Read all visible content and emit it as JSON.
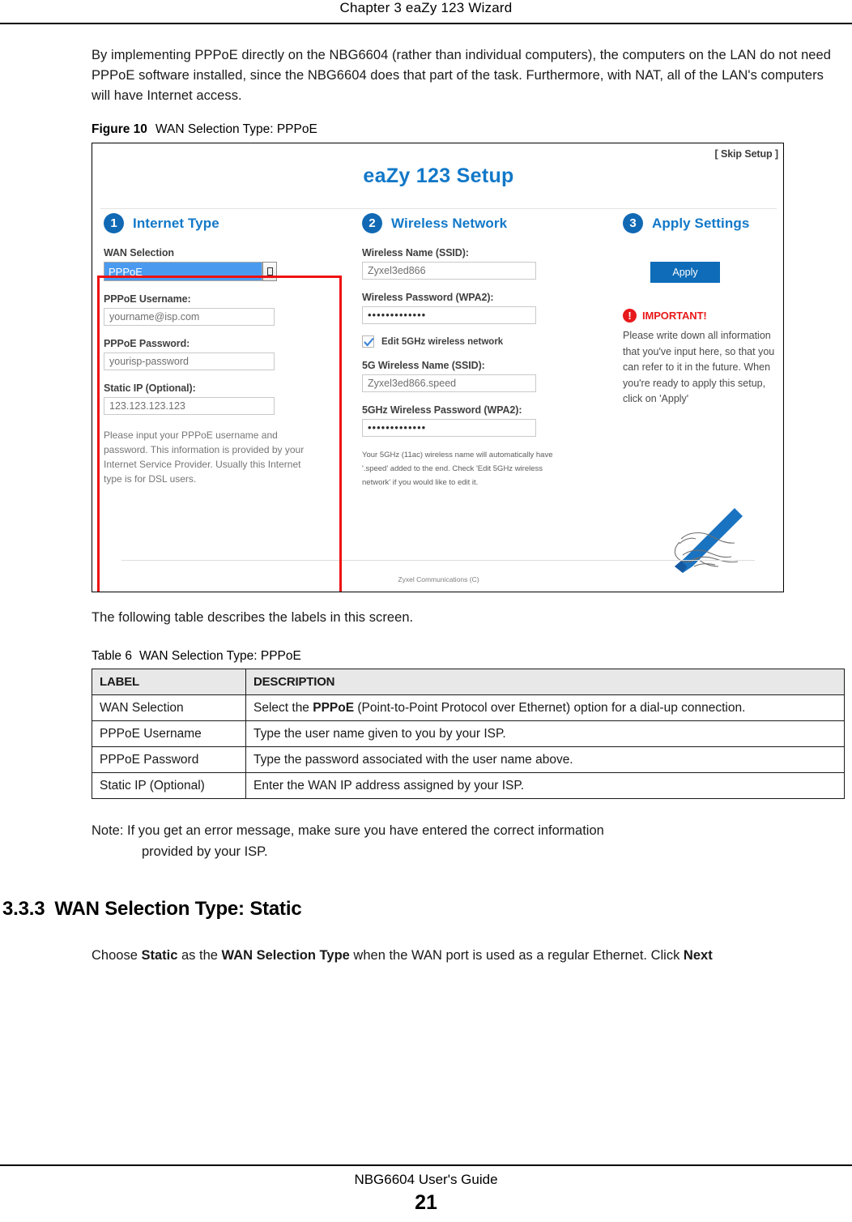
{
  "header": {
    "chapter": "Chapter 3 eaZy 123 Wizard"
  },
  "intro_paragraph": "By implementing PPPoE directly on the NBG6604 (rather than individual computers), the computers on the LAN do not need PPPoE software installed, since the NBG6604 does that part of the task. Furthermore, with NAT, all of the LAN's computers will have Internet access.",
  "figure": {
    "label": "Figure 10",
    "caption": "WAN Selection Type: PPPoE",
    "skip_setup": "[ Skip Setup ]",
    "wizard_title": "eaZy 123 Setup",
    "footer_note": "Zyxel Communications (C)",
    "step1": {
      "number": "1",
      "title": "Internet Type",
      "wan_selection_label": "WAN Selection",
      "wan_selection_value": "PPPoE",
      "username_label": "PPPoE Username:",
      "username_value": "yourname@isp.com",
      "password_label": "PPPoE Password:",
      "password_value": "yourisp-password",
      "static_ip_label": "Static IP (Optional):",
      "static_ip_value": "123.123.123.123",
      "hint": "Please input your PPPoE username and password. This information is provided by your Internet Service Provider. Usually this Internet type is for DSL users."
    },
    "step2": {
      "number": "2",
      "title": "Wireless Network",
      "ssid_label": "Wireless Name (SSID):",
      "ssid_value": "Zyxel3ed866",
      "wpa2_label": "Wireless Password (WPA2):",
      "wpa2_value": "•••••••••••••",
      "edit5g_label": "Edit 5GHz wireless network",
      "ssid5g_label": "5G Wireless Name (SSID):",
      "ssid5g_value": "Zyxel3ed866.speed",
      "wpa25g_label": "5GHz Wireless Password (WPA2):",
      "wpa25g_value": "•••••••••••••",
      "hint": "Your 5GHz (11ac) wireless name will automatically have '.speed' added to the end. Check 'Edit 5GHz wireless network' if you would like to edit it."
    },
    "step3": {
      "number": "3",
      "title": "Apply Settings",
      "apply_label": "Apply",
      "important_label": "IMPORTANT!",
      "important_text": "Please write down all information that you've input here, so that you can refer to it in the future. When you're ready to apply this setup, click on 'Apply'"
    }
  },
  "after_figure_paragraph": "The following table describes the labels in this screen.",
  "table": {
    "label": "Table 6",
    "caption": "WAN Selection Type: PPPoE",
    "columns": [
      "LABEL",
      "DESCRIPTION"
    ],
    "rows": [
      {
        "label": "WAN Selection",
        "desc_pre": "Select the ",
        "desc_bold": "PPPoE",
        "desc_post": " (Point-to-Point Protocol over Ethernet) option for a dial-up connection."
      },
      {
        "label": "PPPoE Username",
        "desc_pre": "Type the user name given to you by your ISP.",
        "desc_bold": "",
        "desc_post": ""
      },
      {
        "label": "PPPoE Password",
        "desc_pre": "Type the password associated with the user name above.",
        "desc_bold": "",
        "desc_post": ""
      },
      {
        "label": "Static IP (Optional)",
        "desc_pre": "Enter the WAN IP address assigned by your ISP.",
        "desc_bold": "",
        "desc_post": ""
      }
    ]
  },
  "note": {
    "line1": "Note: If you get an error message, make sure you have entered the correct information",
    "line2": "provided by your ISP."
  },
  "section": {
    "number": "3.3.3",
    "title": "WAN Selection Type: Static",
    "para_1": "Choose ",
    "para_b1": "Static",
    "para_2": " as the ",
    "para_b2": "WAN Selection Type",
    "para_3": " when the WAN port is used as a regular Ethernet. Click ",
    "para_b3": "Next"
  },
  "footer": {
    "guide": "NBG6604 User's Guide",
    "page": "21"
  },
  "colors": {
    "brand_blue": "#1278c8",
    "badge_blue": "#1169b4",
    "button_blue": "#0e6cb8",
    "select_blue": "#4a9bf0",
    "alert_red": "#e8191b",
    "annotation_red": "#ee1111"
  }
}
